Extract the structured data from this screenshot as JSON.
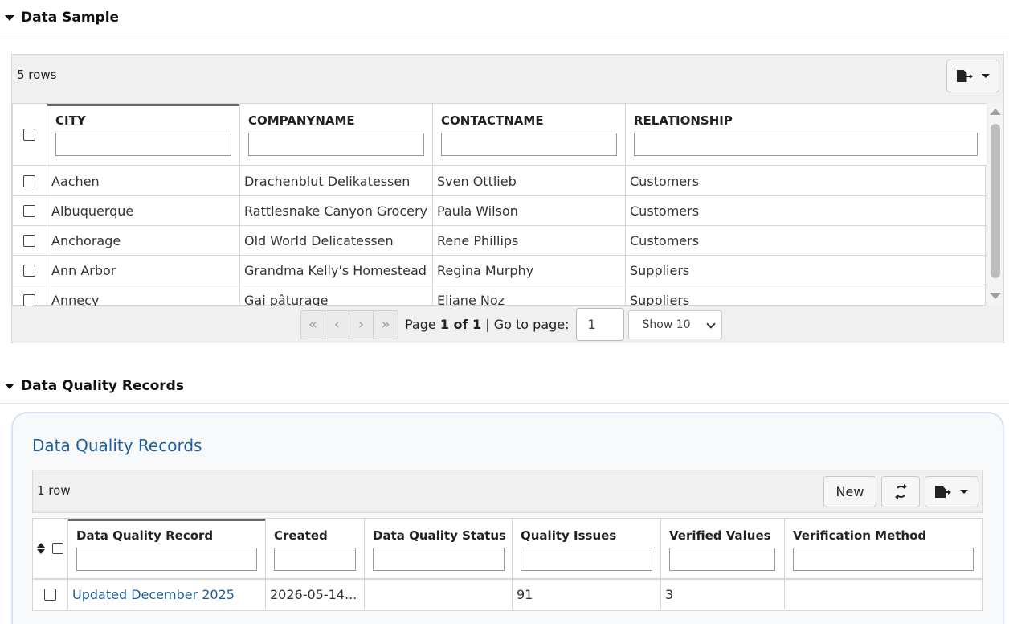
{
  "data_sample": {
    "section_title": "Data Sample",
    "row_count": "5 rows",
    "columns": [
      "CITY",
      "COMPANYNAME",
      "CONTACTNAME",
      "RELATIONSHIP"
    ],
    "rows": [
      [
        "Aachen",
        "Drachenblut Delikatessen",
        "Sven Ottlieb",
        "Customers"
      ],
      [
        "Albuquerque",
        "Rattlesnake Canyon Grocery",
        "Paula Wilson",
        "Customers"
      ],
      [
        "Anchorage",
        "Old World Delicatessen",
        "Rene Phillips",
        "Customers"
      ],
      [
        "Ann Arbor",
        "Grandma Kelly's Homestead",
        "Regina Murphy",
        "Suppliers"
      ],
      [
        "Annecy",
        "Gai pâturage",
        "Eliane Noz",
        "Suppliers"
      ]
    ],
    "pager": {
      "page_prefix": "Page",
      "page_current": "1 of 1",
      "goto_label": "| Go to page:",
      "goto_value": "1",
      "show_label": "Show 10"
    }
  },
  "dq_section": {
    "section_title": "Data Quality Records",
    "card_title": "Data Quality Records",
    "row_count": "1 row",
    "new_label": "New",
    "columns": [
      "Data Quality Record",
      "Created",
      "Data Quality Status",
      "Quality Issues",
      "Verified Values",
      "Verification Method"
    ],
    "rows": [
      [
        "Updated December 2025",
        "2026-05-14...",
        "",
        "91",
        "3",
        ""
      ]
    ]
  }
}
